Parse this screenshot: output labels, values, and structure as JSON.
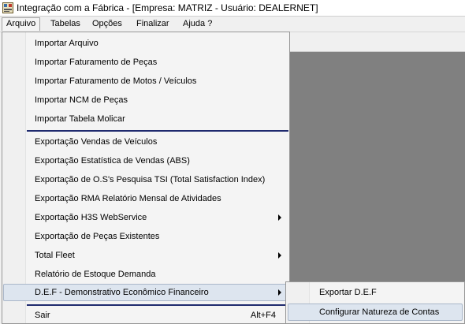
{
  "window": {
    "title": "Integração com a Fábrica - [Empresa: MATRIZ - Usuário: DEALERNET]"
  },
  "menubar": {
    "items": [
      {
        "label": "Arquivo"
      },
      {
        "label": "Tabelas"
      },
      {
        "label": "Opções"
      },
      {
        "label": "Finalizar"
      },
      {
        "label": "Ajuda ?"
      }
    ]
  },
  "arquivo_menu": {
    "items": [
      {
        "label": "Importar Arquivo"
      },
      {
        "label": "Importar Faturamento de Peças"
      },
      {
        "label": "Importar Faturamento de Motos / Veículos"
      },
      {
        "label": "Importar NCM de Peças"
      },
      {
        "label": "Importar Tabela Molicar"
      },
      {
        "label": "Exportação Vendas de Veículos"
      },
      {
        "label": "Exportação Estatística de Vendas (ABS)"
      },
      {
        "label": "Exportação de O.S's Pesquisa TSI (Total Satisfaction Index)"
      },
      {
        "label": "Exportação RMA Relatório Mensal de Atividades"
      },
      {
        "label": "Exportação H3S WebService"
      },
      {
        "label": "Exportação de Peças Existentes"
      },
      {
        "label": "Total Fleet"
      },
      {
        "label": "Relatório de Estoque Demanda"
      },
      {
        "label": "D.E.F - Demonstrativo Econômico Financeiro"
      },
      {
        "label": "Sair",
        "shortcut": "Alt+F4"
      }
    ]
  },
  "def_submenu": {
    "items": [
      {
        "label": "Exportar D.E.F"
      },
      {
        "label": "Configurar Natureza de Contas"
      }
    ]
  },
  "colors": {
    "desktop": "#808080",
    "menu_bg": "#f4f4f4",
    "highlight": "#dde5ef",
    "separator": "#1f2a6e"
  }
}
